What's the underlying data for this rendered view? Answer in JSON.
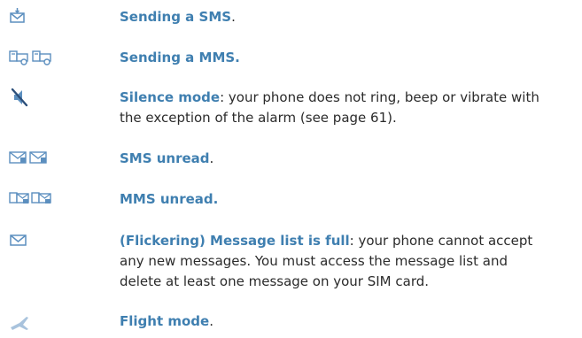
{
  "entries": [
    {
      "icon": "sending-sms-icon",
      "title": "Sending a SMS",
      "body": "."
    },
    {
      "icon": "sending-mms-icon",
      "title": "Sending a MMS.",
      "body": ""
    },
    {
      "icon": "silence-mode-icon",
      "title": "Silence mode",
      "body": ": your phone does not ring, beep or vibrate with the exception of the alarm (see page 61)."
    },
    {
      "icon": "sms-unread-icon",
      "title": "SMS unread",
      "body": "."
    },
    {
      "icon": "mms-unread-icon",
      "title": "MMS unread.",
      "body": ""
    },
    {
      "icon": "message-list-full-icon",
      "title": "(Flickering) Message list is full",
      "body": ": your phone cannot accept any new messages. You must access the message list and delete at least one message on your SIM card."
    },
    {
      "icon": "flight-mode-icon",
      "title": "Flight mode",
      "body": "."
    }
  ],
  "colors": {
    "heading": "#3f7fb0",
    "body": "#2b2b2b",
    "icon": "#5c8fbf"
  }
}
